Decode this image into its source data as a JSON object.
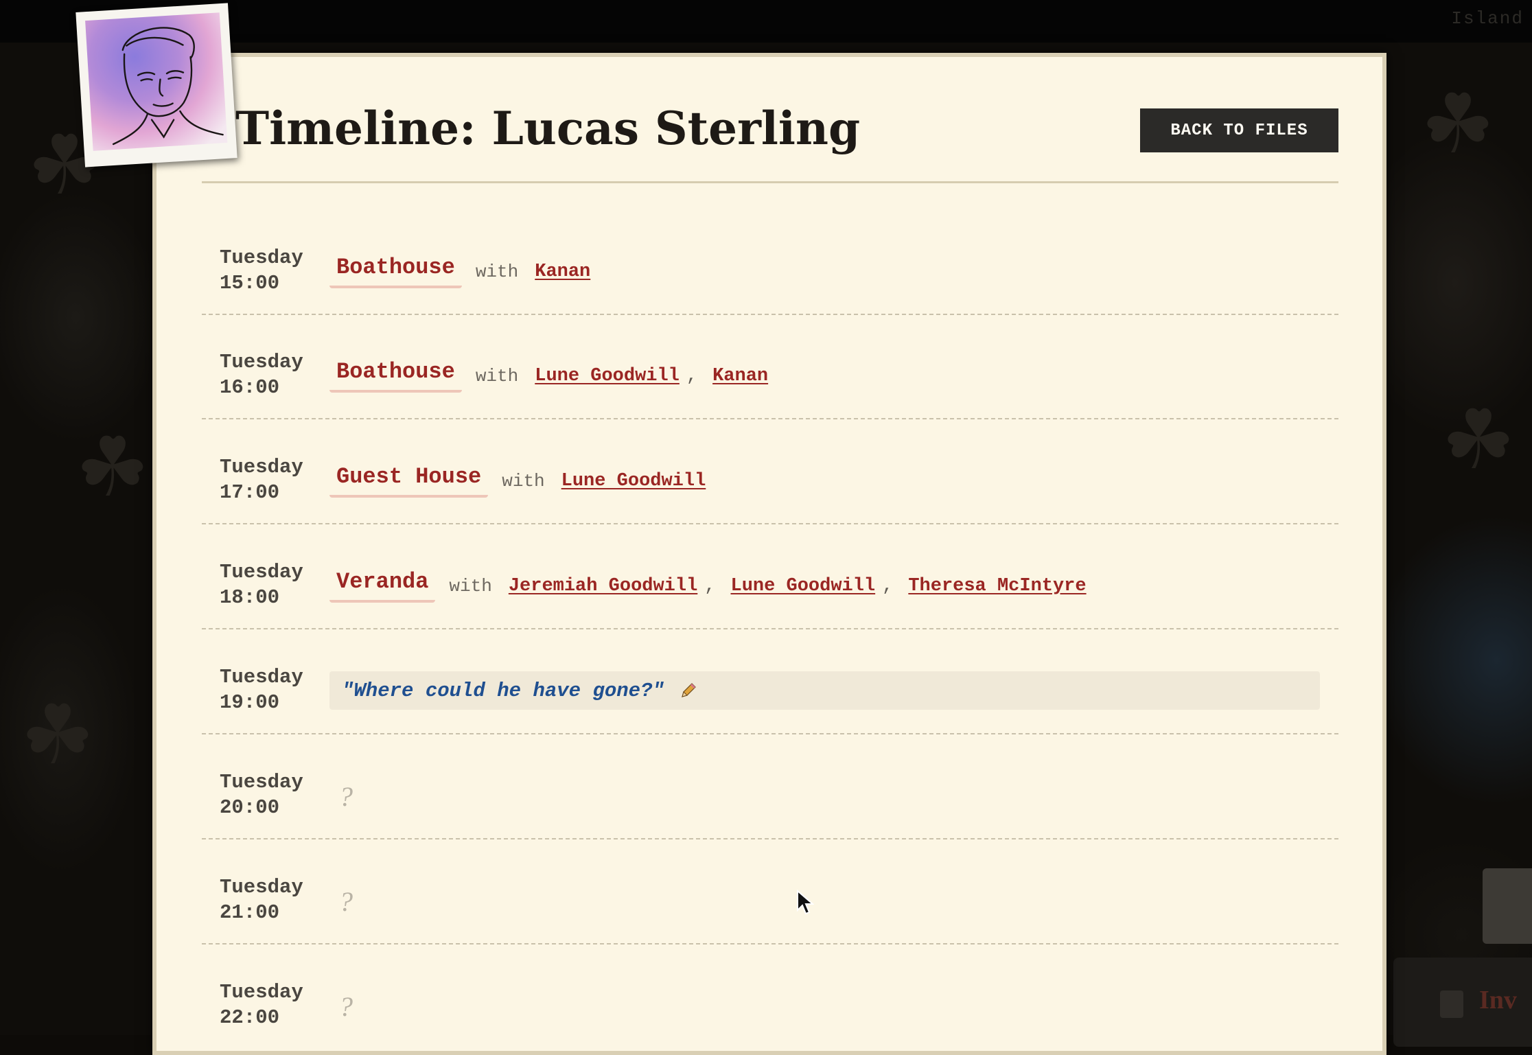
{
  "topbar": {
    "label": "Island"
  },
  "dossier": {
    "title": "Timeline: Lucas Sterling",
    "back_button": "BACK TO FILES",
    "portrait_icon": "suspect-portrait"
  },
  "timeline": [
    {
      "day": "Tuesday",
      "time": "15:00",
      "place": "Boathouse",
      "with": "with",
      "people": [
        "Kanan"
      ]
    },
    {
      "day": "Tuesday",
      "time": "16:00",
      "place": "Boathouse",
      "with": "with",
      "people": [
        "Lune Goodwill",
        "Kanan"
      ]
    },
    {
      "day": "Tuesday",
      "time": "17:00",
      "place": "Guest House",
      "with": "with",
      "people": [
        "Lune Goodwill"
      ]
    },
    {
      "day": "Tuesday",
      "time": "18:00",
      "place": "Veranda",
      "with": "with",
      "people": [
        "Jeremiah Goodwill",
        "Lune Goodwill",
        "Theresa McIntyre"
      ]
    },
    {
      "day": "Tuesday",
      "time": "19:00",
      "note": "\"Where could he have gone?\"",
      "note_icon": "pencil-icon"
    },
    {
      "day": "Tuesday",
      "time": "20:00",
      "unknown": "?"
    },
    {
      "day": "Tuesday",
      "time": "21:00",
      "unknown": "?"
    },
    {
      "day": "Tuesday",
      "time": "22:00",
      "unknown": "?"
    }
  ],
  "separator": ",",
  "inventory": {
    "label": "Inv",
    "icon": "inventory-icon"
  },
  "colors": {
    "paper": "#fcf6e4",
    "accent_red": "#9a2623",
    "note_blue": "#1f4f90",
    "button_dark": "#2b2a28"
  }
}
